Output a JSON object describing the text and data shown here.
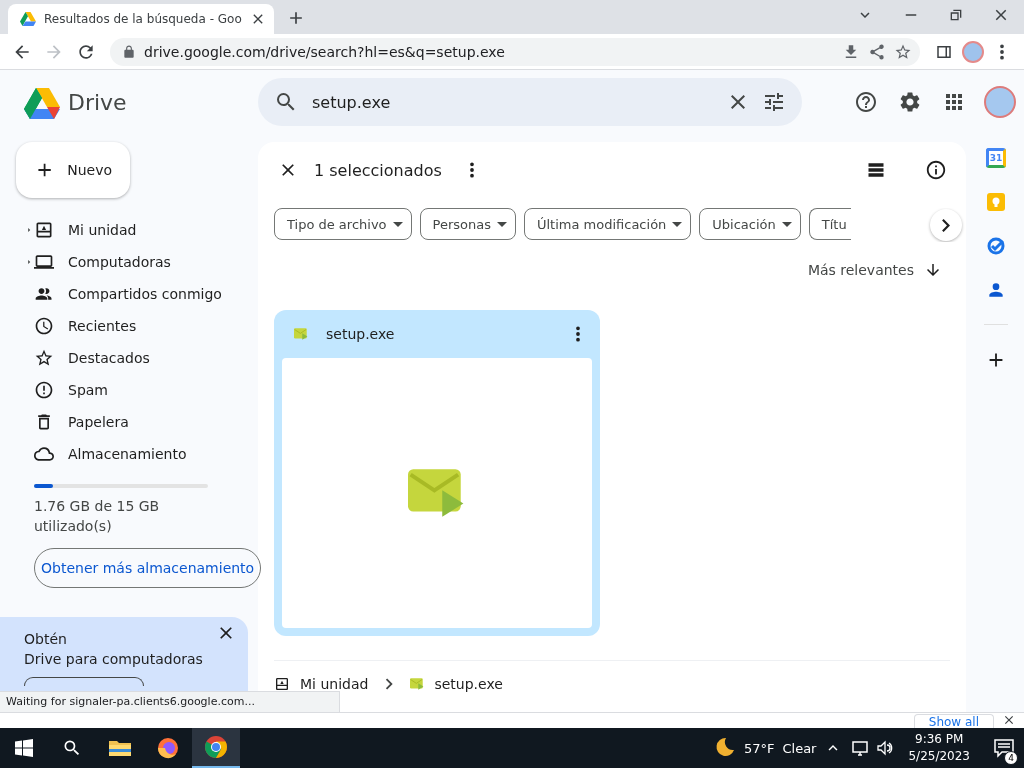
{
  "browser": {
    "tab": {
      "title": "Resultados de la búsqueda - Goo",
      "selected": true
    },
    "url": "drive.google.com/drive/search?hl=es&q=setup.exe",
    "status": "Waiting for signaler-pa.clients6.google.com..."
  },
  "app": {
    "name": "Drive",
    "search": {
      "value": "setup.exe"
    }
  },
  "sidebar": {
    "new_button": "Nuevo",
    "items": [
      {
        "kind": "drive",
        "label": "Mi unidad",
        "expanded": false,
        "selected": false
      },
      {
        "kind": "computers",
        "label": "Computadoras",
        "expanded": false,
        "selected": false
      },
      {
        "kind": "shared",
        "label": "Compartidos conmigo",
        "selected": false
      },
      {
        "kind": "recent",
        "label": "Recientes",
        "selected": false
      },
      {
        "kind": "starred",
        "label": "Destacados",
        "selected": false
      },
      {
        "kind": "spam",
        "label": "Spam",
        "selected": false
      },
      {
        "kind": "trash",
        "label": "Papelera",
        "selected": false
      },
      {
        "kind": "storage",
        "label": "Almacenamiento",
        "selected": false
      }
    ],
    "storage": {
      "level": 0.11,
      "text": "1.76 GB de 15 GB utilizado(s)",
      "button": "Obtener más almacenamiento"
    },
    "promo": {
      "title": "Obtén",
      "text": "Drive para computadoras"
    }
  },
  "selection": {
    "count": "1 seleccionados"
  },
  "filters": [
    {
      "label": "Tipo de archivo"
    },
    {
      "label": "Personas"
    },
    {
      "label": "Última modificación"
    },
    {
      "label": "Ubicación"
    },
    {
      "label": "Títu"
    }
  ],
  "sort": {
    "label": "Más relevantes"
  },
  "files": [
    {
      "name": "setup.exe",
      "selected": true
    }
  ],
  "breadcrumb": [
    "Mi unidad",
    "setup.exe"
  ],
  "side_panel": {
    "calendar_day": "31"
  },
  "downloads": {
    "show_all": "Show all"
  },
  "taskbar": {
    "apps": [
      {
        "kind": "explorer",
        "selected": false
      },
      {
        "kind": "firefox",
        "selected": false
      },
      {
        "kind": "chrome",
        "selected": true
      }
    ],
    "weather": {
      "temp": "57°F",
      "condition": "Clear"
    },
    "time": "9:36 PM",
    "date": "5/25/2023",
    "notifications": "4"
  }
}
